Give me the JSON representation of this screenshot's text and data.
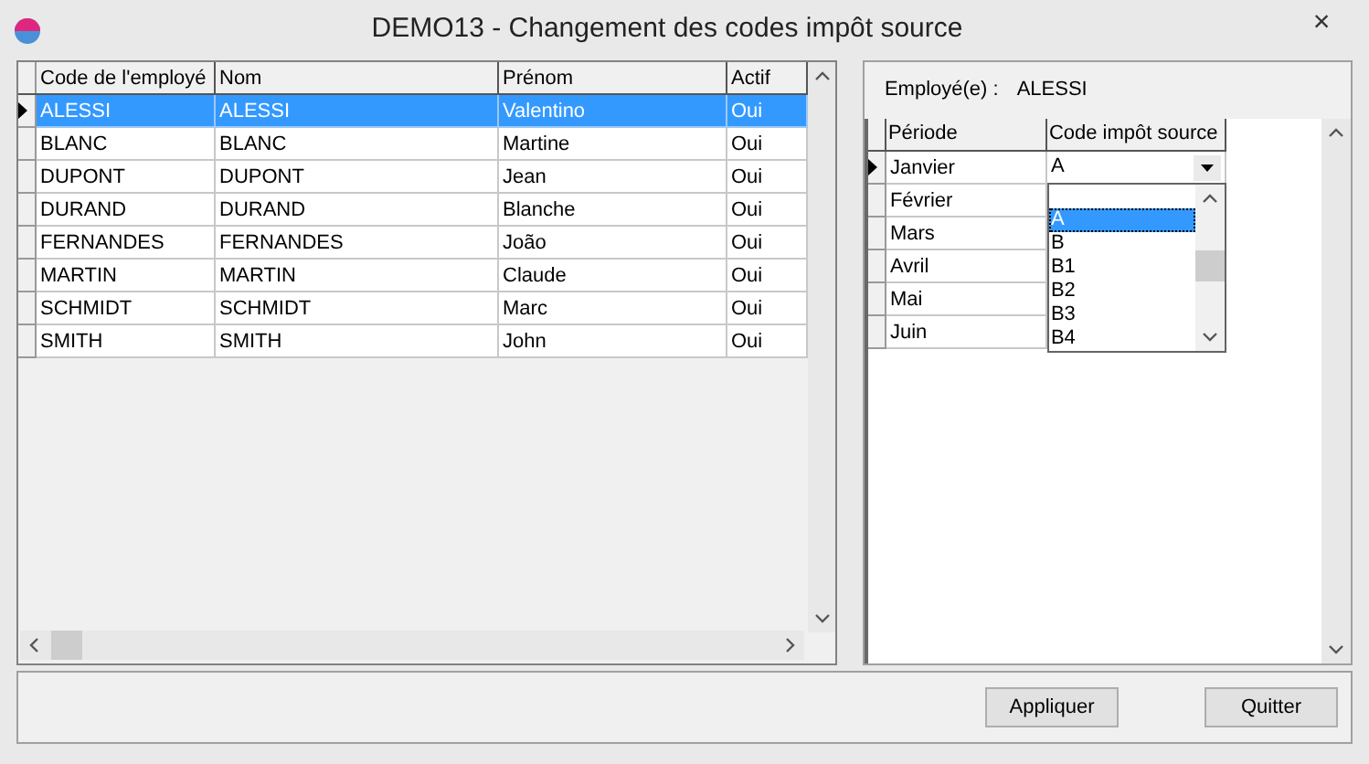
{
  "window": {
    "title": "DEMO13 - Changement des codes impôt source",
    "close": "×"
  },
  "employees": {
    "columns": [
      "Code de l'employé",
      "Nom",
      "Prénom",
      "Actif"
    ],
    "rows": [
      {
        "cells": [
          "ALESSI",
          "ALESSI",
          "Valentino",
          "Oui"
        ],
        "selected": true
      },
      {
        "cells": [
          "BLANC",
          "BLANC",
          "Martine",
          "Oui"
        ],
        "selected": false
      },
      {
        "cells": [
          "DUPONT",
          "DUPONT",
          "Jean",
          "Oui"
        ],
        "selected": false
      },
      {
        "cells": [
          "DURAND",
          "DURAND",
          "Blanche",
          "Oui"
        ],
        "selected": false
      },
      {
        "cells": [
          "FERNANDES",
          "FERNANDES",
          "João",
          "Oui"
        ],
        "selected": false
      },
      {
        "cells": [
          "MARTIN",
          "MARTIN",
          "Claude",
          "Oui"
        ],
        "selected": false
      },
      {
        "cells": [
          "SCHMIDT",
          "SCHMIDT",
          "Marc",
          "Oui"
        ],
        "selected": false
      },
      {
        "cells": [
          "SMITH",
          "SMITH",
          "John",
          "Oui"
        ],
        "selected": false
      }
    ]
  },
  "employee_info": {
    "label": "Employé(e) :",
    "value": "ALESSI"
  },
  "periods": {
    "columns": [
      "Période",
      "Code impôt source"
    ],
    "rows": [
      {
        "period": "Janvier",
        "code": "A",
        "selected": true
      },
      {
        "period": "Février",
        "selected": false
      },
      {
        "period": "Mars",
        "selected": false
      },
      {
        "period": "Avril",
        "selected": false
      },
      {
        "period": "Mai",
        "selected": false
      },
      {
        "period": "Juin",
        "selected": false
      }
    ]
  },
  "code_dropdown": {
    "options": [
      {
        "label": "A",
        "selected": true
      },
      {
        "label": "B",
        "selected": false
      },
      {
        "label": "B1",
        "selected": false
      },
      {
        "label": "B2",
        "selected": false
      },
      {
        "label": "B3",
        "selected": false
      },
      {
        "label": "B4",
        "selected": false
      }
    ]
  },
  "buttons": [
    "Appliquer",
    "Quitter"
  ]
}
